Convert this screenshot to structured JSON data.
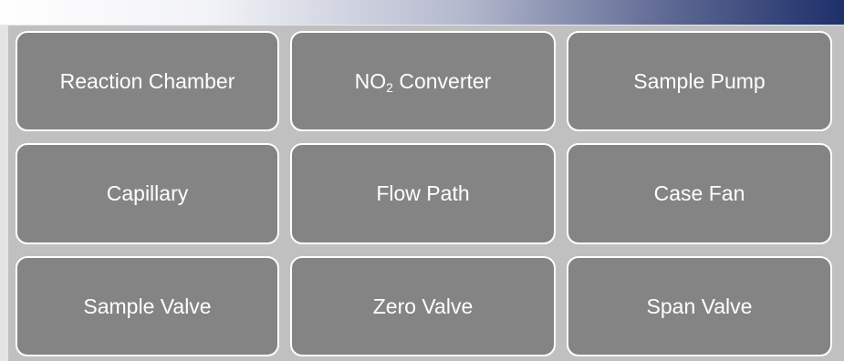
{
  "buttons": {
    "reaction_chamber": "Reaction Chamber",
    "no2_converter_prefix": "NO",
    "no2_converter_subscript": "2",
    "no2_converter_suffix": " Converter",
    "sample_pump": "Sample Pump",
    "capillary": "Capillary",
    "flow_path": "Flow Path",
    "case_fan": "Case Fan",
    "sample_valve": "Sample Valve",
    "zero_valve": "Zero Valve",
    "span_valve": "Span Valve"
  },
  "colors": {
    "background": "#c0c0c0",
    "button_fill": "#848484",
    "button_border": "#ffffff",
    "button_text": "#ffffff",
    "title_bar_end": "#1e2f6a"
  }
}
